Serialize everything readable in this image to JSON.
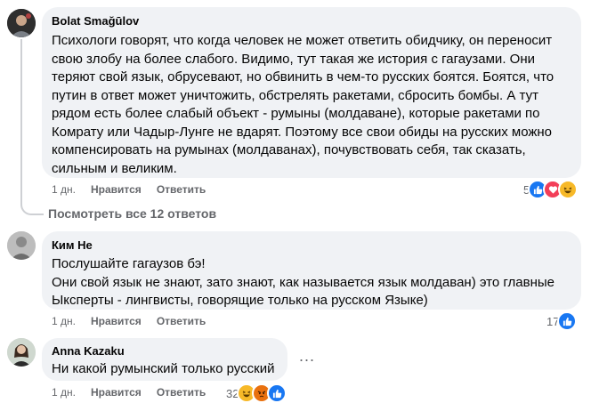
{
  "comments": [
    {
      "author": "Bolat Smağūlov",
      "lines": [
        "Психологи говорят, что когда человек не может ответить обидчику, он переносит",
        "свою злобу на более слабого. Видимо, тут такая же история с гагаузами. Они",
        "теряют свой язык, обрусевают, но обвинить в чем-то русских боятся. Боятся, что",
        "путин в ответ может уничтожить, обстрелять ракетами, сбросить бомбы. А тут",
        "рядом есть более слабый объект - румыны (молдаване), которые ракетами по",
        "Комрату или Чадыр-Лунге не вдарят. Поэтому все свои обиды на русских можно",
        "компенсировать на румынах (молдаванах), почувствовать себя, так сказать,",
        "сильным и великим."
      ],
      "time": "1 дн.",
      "like_label": "Нравится",
      "reply_label": "Ответить",
      "reactions_count": "5",
      "reactions": [
        "like-icon",
        "love-icon",
        "haha-icon"
      ]
    },
    {
      "author": "Ким Не",
      "lines": [
        "Послушайте гагаузов бэ!",
        "Они свой язык не знают, зато знают, как называется язык молдаван) это главные",
        "Ыксперты - лингвисты, говорящие только на русском Языке)"
      ],
      "time": "1 дн.",
      "like_label": "Нравится",
      "reply_label": "Ответить",
      "reactions_count": "17",
      "reactions": [
        "like-icon"
      ]
    },
    {
      "author": "Anna Kazaku",
      "lines": [
        "Ни какой румынский только русский"
      ],
      "time": "1 дн.",
      "like_label": "Нравится",
      "reply_label": "Ответить",
      "reactions_count": "32",
      "reactions": [
        "haha-icon",
        "angry-icon",
        "like-icon"
      ]
    }
  ],
  "view_replies": "Посмотреть все 12 ответов",
  "more_label": "...",
  "colors": {
    "bubble": "#f0f2f5",
    "like": "#1877f2",
    "love": "#f33e58",
    "haha": "#f7b928",
    "angry": "#e9710f",
    "secondary_text": "#65676b"
  }
}
